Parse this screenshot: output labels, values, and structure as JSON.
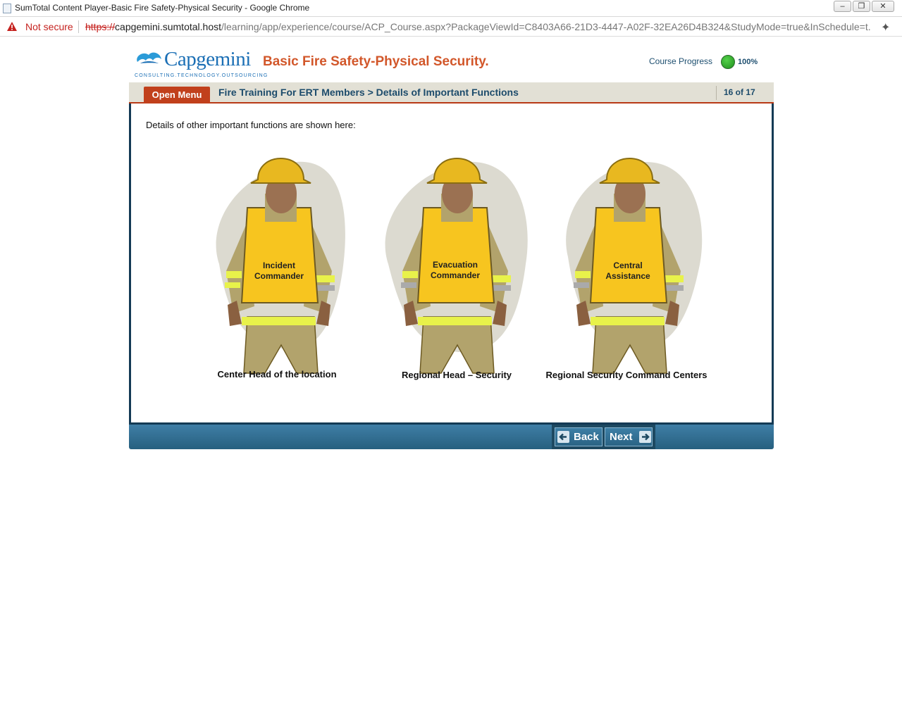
{
  "browser": {
    "window_title": "SumTotal Content Player-Basic Fire Safety-Physical Security - Google Chrome",
    "security_label": "Not secure",
    "url_scheme": "https://",
    "url_host": "capgemini.sumtotal.host",
    "url_path": "/learning/app/experience/course/ACP_Course.aspx?PackageViewId=C8403A66-21D3-4447-A02F-32EA26D4B324&StudyMode=true&InSchedule=t..."
  },
  "header": {
    "logo_text": "Capgemini",
    "logo_tagline": "CONSULTING.TECHNOLOGY.OUTSOURCING",
    "course_title": "Basic Fire Safety-Physical Security.",
    "progress_label": "Course Progress",
    "progress_value": "100%"
  },
  "navbar": {
    "menu_label": "Open Menu",
    "breadcrumb": "Fire Training For ERT Members > Details of Important Functions",
    "page_indicator": "16 of 17"
  },
  "content": {
    "intro": "Details of other important functions are shown here:",
    "figures": [
      {
        "vest_line1": "Incident",
        "vest_line2": "Commander",
        "caption": "Center Head of the location"
      },
      {
        "vest_line1": "Evacuation",
        "vest_line2": "Commander",
        "caption": "Regional Head – Security"
      },
      {
        "vest_line1": "Central",
        "vest_line2": "Assistance",
        "caption": "Regional Security Command Centers"
      }
    ]
  },
  "footer": {
    "back_label": "Back",
    "next_label": "Next"
  },
  "colors": {
    "brand_blue": "#1b6fb5",
    "title_orange": "#d2572a",
    "menu_red": "#c1401c",
    "vest_yellow": "#f7c51f",
    "reflective_green": "#e8f24a",
    "progress_green": "#2fa52a"
  }
}
